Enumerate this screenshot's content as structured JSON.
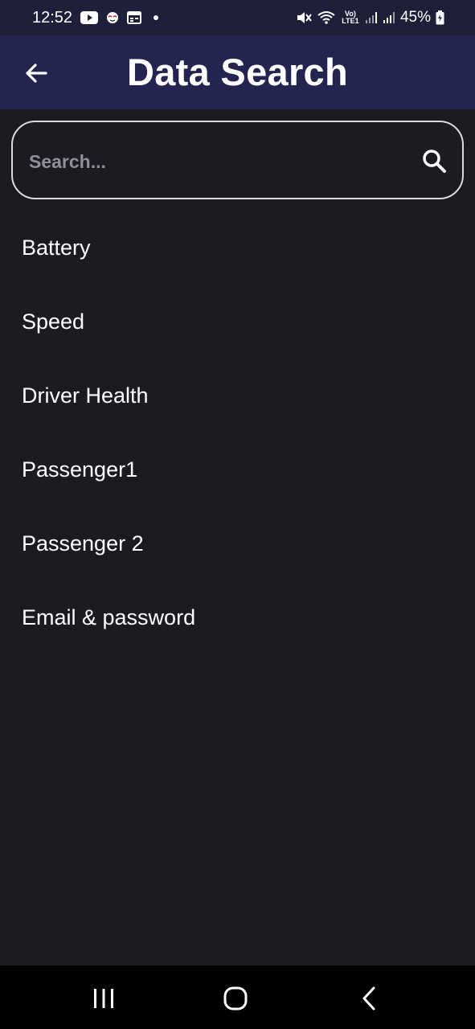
{
  "status_bar": {
    "time": "12:52",
    "left_icons": [
      "youtube-icon",
      "mascot-notification-icon",
      "calendar-icon",
      "dot-icon"
    ],
    "right_icons": [
      "mute-icon",
      "wifi-icon",
      "volte-icon",
      "signal-icon",
      "signal-icon",
      "battery-icon"
    ],
    "volte_label": "Vo) LTE1",
    "battery_percent": "45%"
  },
  "app_bar": {
    "title": "Data Search",
    "back_icon": "arrow-left-icon"
  },
  "search": {
    "placeholder": "Search...",
    "value": "",
    "icon": "search-icon"
  },
  "items": [
    {
      "label": "Battery"
    },
    {
      "label": "Speed"
    },
    {
      "label": "Driver Health"
    },
    {
      "label": "Passenger1"
    },
    {
      "label": "Passenger 2"
    },
    {
      "label": "Email & password"
    }
  ],
  "nav_bar": {
    "buttons": [
      "recent-apps-icon",
      "home-icon",
      "back-icon"
    ]
  },
  "colors": {
    "background": "#1b1c22",
    "app_bar": "#242450",
    "status_bar": "#1f1f3a",
    "text": "#ffffff",
    "placeholder": "#8f8f98",
    "search_border": "#d9d9de"
  }
}
